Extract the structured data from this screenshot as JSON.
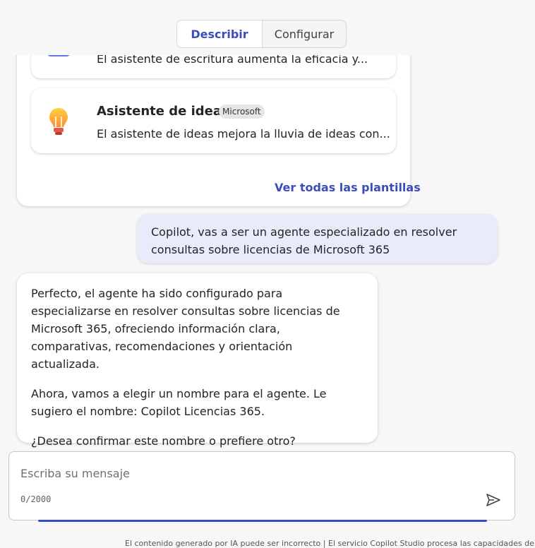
{
  "tabs": {
    "describe": "Describir",
    "configure": "Configurar"
  },
  "templates": {
    "writer_description": "El asistente de escritura aumenta la eficacia y...",
    "ideas_title": "Asistente de ideas",
    "ideas_badge": "Microsoft",
    "ideas_description": "El asistente de ideas mejora la lluvia de ideas con...",
    "see_all": "Ver todas las plantillas"
  },
  "conversation": {
    "user_message": "Copilot, vas a ser un agente especializado en resolver consultas sobre licencias de Microsoft 365",
    "bot_paragraphs": [
      "Perfecto, el agente ha sido configurado para especializarse en resolver consultas sobre licencias de Microsoft 365, ofreciendo información clara, comparativas, recomendaciones y orientación actualizada.",
      "Ahora, vamos a elegir un nombre para el agente. Le sugiero el nombre: Copilot Licencias 365.",
      "¿Desea confirmar este nombre o prefiere otro?"
    ]
  },
  "composer": {
    "placeholder": "Escriba su mensaje",
    "value": "",
    "counter": "0/2000"
  },
  "disclaimer": "El contenido generado por IA puede ser incorrecto | El servicio Copilot Studio procesa las capacidades de",
  "colors": {
    "accent": "#3b4dbd",
    "user_bubble": "#e8ebfa"
  },
  "icons": [
    "writing-assistant-icon",
    "lightbulb-icon",
    "send-icon"
  ]
}
